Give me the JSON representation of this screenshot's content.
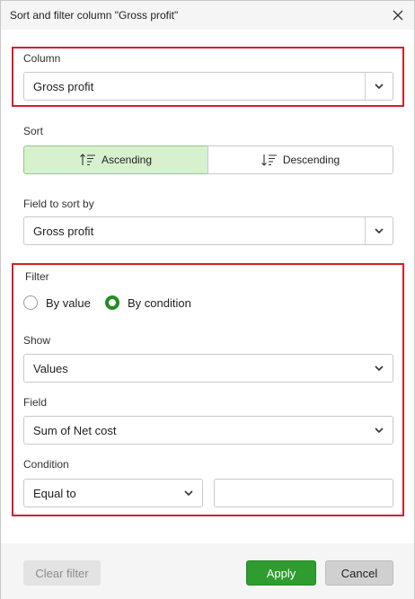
{
  "dialog": {
    "title": "Sort and filter column \"Gross profit\""
  },
  "column": {
    "label": "Column",
    "value": "Gross profit"
  },
  "sort": {
    "label": "Sort",
    "ascending_label": "Ascending",
    "descending_label": "Descending",
    "selected": "Ascending"
  },
  "sort_field": {
    "label": "Field to sort by",
    "value": "Gross profit"
  },
  "filter": {
    "label": "Filter",
    "by_value_label": "By value",
    "by_condition_label": "By condition",
    "selected": "By condition",
    "show": {
      "label": "Show",
      "value": "Values"
    },
    "field": {
      "label": "Field",
      "value": "Sum of Net cost"
    },
    "condition": {
      "label": "Condition",
      "value": "Equal to",
      "input_value": ""
    }
  },
  "footer": {
    "clear_label": "Clear filter",
    "apply_label": "Apply",
    "cancel_label": "Cancel"
  },
  "colors": {
    "highlight": "#d61f2a",
    "active_segment": "#d7f1cf",
    "apply": "#2e9c2e",
    "radio_on": "#1f8f1f"
  },
  "icons": {
    "close": "close-icon",
    "dropdown": "chevron-down-icon",
    "sort_asc": "sort-ascending-icon",
    "sort_desc": "sort-descending-icon"
  }
}
